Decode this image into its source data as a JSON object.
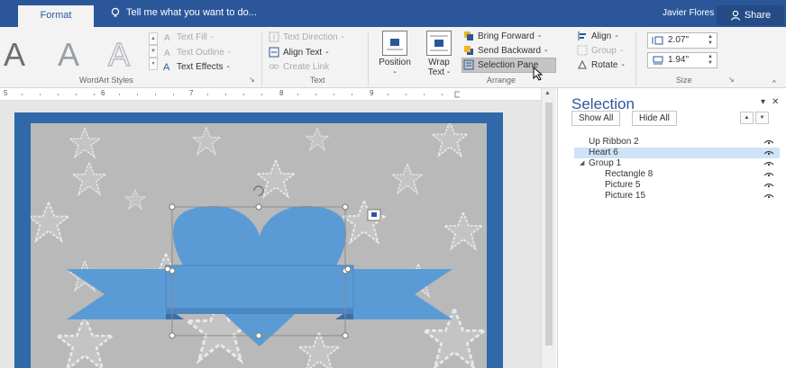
{
  "tabbar": {
    "active_tab": "Format",
    "tell_me": "Tell me what you want to do...",
    "user": "Javier Flores",
    "share": "Share"
  },
  "ribbon": {
    "wordart": {
      "letters": [
        "A",
        "A",
        "A"
      ],
      "text_fill": "Text Fill",
      "text_outline": "Text Outline",
      "text_effects": "Text Effects",
      "group_label": "WordArt Styles"
    },
    "text": {
      "text_direction": "Text Direction",
      "align_text": "Align Text",
      "create_link": "Create Link",
      "group_label": "Text"
    },
    "arrange": {
      "position": "Position",
      "wrap_line1": "Wrap",
      "wrap_line2": "Text",
      "bring_forward": "Bring Forward",
      "send_backward": "Send Backward",
      "selection_pane": "Selection Pane",
      "align": "Align",
      "group": "Group",
      "rotate": "Rotate",
      "group_label": "Arrange"
    },
    "size": {
      "height": "2.07\"",
      "width": "1.94\"",
      "group_label": "Size"
    }
  },
  "ruler": {
    "marks": [
      "5",
      "6",
      "7",
      "8",
      "9"
    ]
  },
  "selection_pane": {
    "title": "Selection",
    "show_all": "Show All",
    "hide_all": "Hide All",
    "items": [
      {
        "label": "Up Ribbon 2"
      },
      {
        "label": "Heart 6"
      },
      {
        "label": "Group 1"
      },
      {
        "label": "Rectangle 8"
      },
      {
        "label": "Picture 5"
      },
      {
        "label": "Picture 15"
      }
    ]
  },
  "colors": {
    "accent": "#2b579a",
    "shape_fill": "#5b9bd5",
    "page_border": "#2f69a8",
    "selected_row": "#cfe3f7"
  }
}
